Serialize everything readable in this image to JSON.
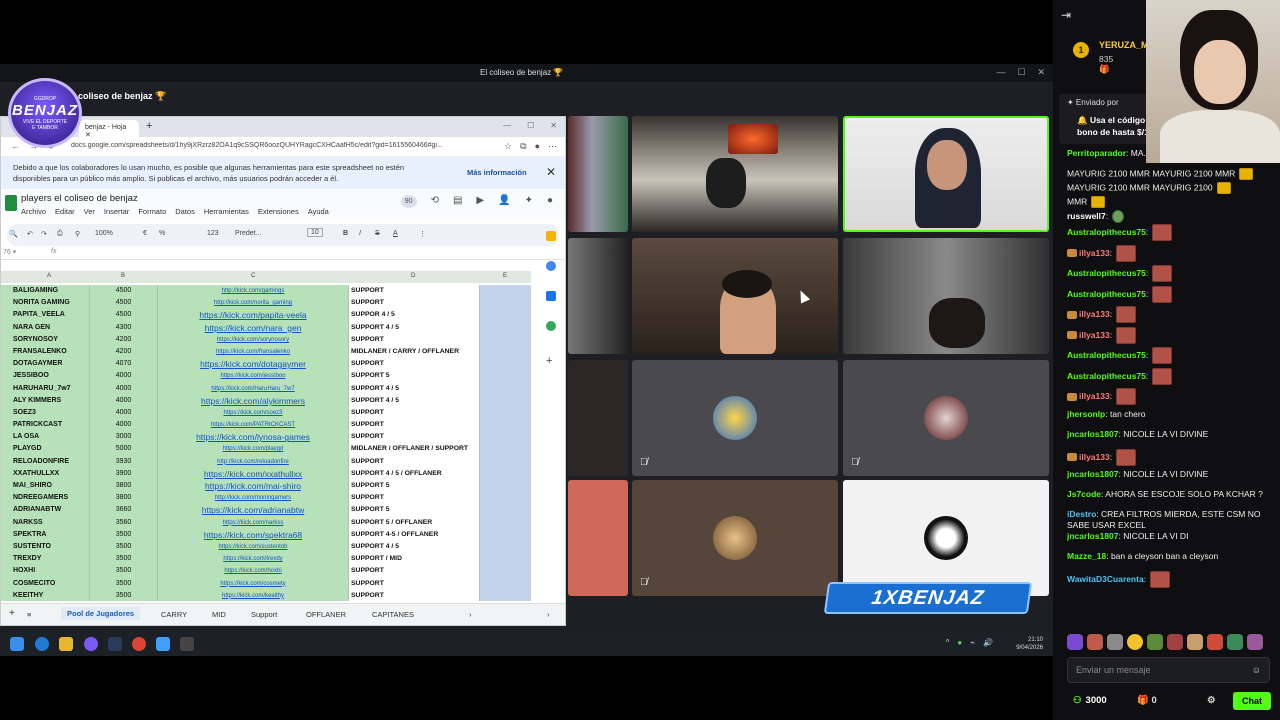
{
  "window": {
    "title": "El coliseo de benjaz 🏆",
    "server_name": "coliseo de benjaz 🏆"
  },
  "logo": {
    "main": "BENJAZ",
    "top": "GGDROP",
    "bottom": "VIVE EL DEPORTE",
    "tiny": "E TAMBOR"
  },
  "browser": {
    "tab_label": "benjaz - Hoja",
    "url": "docs.google.com/spreadsheets/d/1hy9jXRzrz82OA1q9cSSQR6oozQUHYRagcCXHCaafH5c/edit?gid=1615560466#gi..."
  },
  "notice": {
    "message": "Debido a que los colaboradores lo usan mucho, es posible que algunas herramientas para este spreadsheet no estén disponibles para un público más amplio. Si publicas el archivo, más usuarios podrán acceder a él.",
    "more": "Más información",
    "close": "✕"
  },
  "sheet": {
    "title": "players el coliseo de benjaz",
    "menus": [
      "Archivo",
      "Editar",
      "Ver",
      "Insertar",
      "Formato",
      "Datos",
      "Herramientas",
      "Extensiones",
      "Ayuda"
    ],
    "toolbar": {
      "zoom": "100%",
      "font": "Predet...",
      "size": "10",
      "currency": "€",
      "percent": "%",
      "num": "123"
    },
    "collab_count": "90",
    "columns": [
      "A",
      "B",
      "C",
      "D",
      "E"
    ],
    "rows": [
      {
        "name": "BALIGAMING",
        "mmr": "4500",
        "link": "http://kick.com/gamings",
        "role": "SUPPORT",
        "sz": "sm"
      },
      {
        "name": "NORITA GAMING",
        "mmr": "4500",
        "link": "http://kick.com/norita_gaming",
        "role": "SUPPORT",
        "sz": "sm"
      },
      {
        "name": "PAPITA_VEELA",
        "mmr": "4500",
        "link": "https://kick.com/papita-veela",
        "role": "SUPPOR 4 / 5",
        "sz": "big"
      },
      {
        "name": "NARA GEN",
        "mmr": "4300",
        "link": "https://kick.com/nara_gen",
        "role": "SUPPORT 4 / 5",
        "sz": "big"
      },
      {
        "name": "SORYNOSOY",
        "mmr": "4200",
        "link": "https://kick.com/sorynosory",
        "role": "SUPPORT",
        "sz": "sm"
      },
      {
        "name": "FRANSALENKO",
        "mmr": "4200",
        "link": "https://kick.com/fransalenko",
        "role": "MIDLANER / CARRY / OFFLANER",
        "sz": "sm"
      },
      {
        "name": "DOTAGAYMER",
        "mmr": "4070",
        "link": "https://kick.com/dotagaymer",
        "role": "SUPPORT",
        "sz": "big"
      },
      {
        "name": "JESSIBOO",
        "mmr": "4000",
        "link": "https://kick.com/jessiboo",
        "role": "SUPPORT 5",
        "sz": "sm"
      },
      {
        "name": "HARUHARU_7w7",
        "mmr": "4000",
        "link": "https://kick.com/HaruHaru_7w7",
        "role": "SUPPORT 4 / 5",
        "sz": "sm"
      },
      {
        "name": "ALY KIMMERS",
        "mmr": "4000",
        "link": "https://kick.com/alykimmers",
        "role": "SUPPORT 4 / 5",
        "sz": "big"
      },
      {
        "name": "SOEZ3",
        "mmr": "4000",
        "link": "https://kick.com/soez3",
        "role": "SUPPORT",
        "sz": "sm"
      },
      {
        "name": "PATRICKCAST",
        "mmr": "4000",
        "link": "https://kick.com/PATRICKCAST",
        "role": "SUPPORT",
        "sz": "sm"
      },
      {
        "name": "LA OSA",
        "mmr": "3000",
        "link": "https://kick.com/lynosa-games",
        "role": "SUPPORT",
        "sz": "big"
      },
      {
        "name": "PLAYGD",
        "mmr": "5000",
        "link": "https://kick.com/playgd",
        "role": "MIDLANER / OFFLANER / SUPPORT",
        "sz": "sm"
      },
      {
        "name": "RELOADONFIRE",
        "mmr": "3930",
        "link": "http://kick.com/reloadonfire",
        "role": "SUPPORT",
        "sz": "sm"
      },
      {
        "name": "XXATHULLXX",
        "mmr": "3900",
        "link": "https://kick.com/xxathullxx",
        "role": "SUPPORT 4 / 5 / OFFLANER",
        "sz": "big"
      },
      {
        "name": "MAI_SHIRO",
        "mmr": "3800",
        "link": "https://kick.com/mai-shiro",
        "role": "SUPPORT 5",
        "sz": "big"
      },
      {
        "name": "NDREEGAMERS",
        "mmr": "3800",
        "link": "http://kick.com/moningamers",
        "role": "SUPPORT",
        "sz": "sm"
      },
      {
        "name": "ADRIANABTW",
        "mmr": "3660",
        "link": "https://kick.com/adrianabtw",
        "role": "SUPPORT 5",
        "sz": "big"
      },
      {
        "name": "NARKSS",
        "mmr": "3560",
        "link": "https://kick.com/narkss",
        "role": "SUPPORT 5 / OFFLANER",
        "sz": "sm"
      },
      {
        "name": "SPEKTRA",
        "mmr": "3500",
        "link": "https://kick.com/spektra68",
        "role": "SUPPORT 4-5 / OFFLANER",
        "sz": "big"
      },
      {
        "name": "SUSTENTO",
        "mmr": "3500",
        "link": "https://kick.com/sustentob",
        "role": "SUPPORT 4 / 5",
        "sz": "sm"
      },
      {
        "name": "TREXDY",
        "mmr": "3500",
        "link": "https://kick.com/trexdy",
        "role": "SUPPORT / MID",
        "sz": "sm"
      },
      {
        "name": "HOXHI",
        "mmr": "3500",
        "link": "https://kick.com/hoxhi",
        "role": "SUPPORT",
        "sz": "sm"
      },
      {
        "name": "COSMECITO",
        "mmr": "3500",
        "link": "https://kick.com/cosmety",
        "role": "SUPPORT",
        "sz": "sm"
      },
      {
        "name": "KEEITHY",
        "mmr": "3500",
        "link": "https://kick.com/keeithy",
        "role": "SUPPORT",
        "sz": "sm"
      }
    ],
    "tabs": [
      "Pool de Jugadores",
      "CARRY",
      "MID",
      "Support",
      "OFFLANER",
      "CAPITANES"
    ]
  },
  "taskbar": {
    "time": "21:10",
    "date": "9/04/2026"
  },
  "overlay": {
    "brand": "1XBENJAZ"
  },
  "chat": {
    "top_gifter": {
      "rank": "1",
      "name": "YERUZA_M",
      "count": "835 🎁"
    },
    "pinned": {
      "header": "✦ Enviado por",
      "line1": "🔔 Usa el código 1",
      "line2": "bono de hasta $/1"
    },
    "messages": [
      {
        "user": "Perritoparador",
        "color": "#53fc18",
        "text": ": MA..",
        "emote": ""
      },
      {
        "user": "",
        "color": "",
        "text": "MAYURIG 2100 MMR  MAYURIG 2100 MMR",
        "emote": "y"
      },
      {
        "user": "",
        "color": "",
        "text": "MAYURIG 2100 MMR  MAYURIG 2100",
        "emote": "y"
      },
      {
        "user": "",
        "color": "",
        "text": "MMR",
        "emote": "y"
      },
      {
        "user": "russwell7",
        "color": "#ffffff",
        "text": ":",
        "emote": "g"
      },
      {
        "user": "Australopithecus75",
        "color": "#53fc18",
        "text": ":",
        "emote": "r"
      },
      {
        "user": "illya133",
        "color": "#ff7a7a",
        "text": ":",
        "emote": "r",
        "badge": true
      },
      {
        "user": "Australopithecus75",
        "color": "#53fc18",
        "text": ":",
        "emote": "r"
      },
      {
        "user": "Australopithecus75",
        "color": "#53fc18",
        "text": ":",
        "emote": "r"
      },
      {
        "user": "illya133",
        "color": "#ff7a7a",
        "text": ":",
        "emote": "r",
        "badge": true
      },
      {
        "user": "illya133",
        "color": "#ff7a7a",
        "text": ":",
        "emote": "r",
        "badge": true
      },
      {
        "user": "Australopithecus75",
        "color": "#53fc18",
        "text": ":",
        "emote": "r"
      },
      {
        "user": "Australopithecus75",
        "color": "#53fc18",
        "text": ":",
        "emote": "r"
      },
      {
        "user": "illya133",
        "color": "#ff7a7a",
        "text": ":",
        "emote": "r",
        "badge": true
      },
      {
        "user": "jhersonlp",
        "color": "#53fc18",
        "text": ": tan chero",
        "emote": ""
      },
      {
        "user": "jncarlos1807",
        "color": "#53fc18",
        "text": ": NICOLE LA VI DIVINE",
        "emote": ""
      },
      {
        "user": "illya133",
        "color": "#ff7a7a",
        "text": ":",
        "emote": "r",
        "badge": true
      },
      {
        "user": "jncarlos1807",
        "color": "#53fc18",
        "text": ": NICOLE LA VI DIVINE",
        "emote": ""
      },
      {
        "user": "Js7code",
        "color": "#53fc18",
        "text": ": AHORA SE ESCOJE SOLO PA KCHAR ?",
        "emote": ""
      },
      {
        "user": "iDestro",
        "color": "#4fc3f7",
        "text": ": CREA FILTROS MIERDA, ESTE CSM NO SABE USAR EXCEL",
        "emote": ""
      },
      {
        "user": "jncarlos1807",
        "color": "#53fc18",
        "text": ": NICOLE LA VI DI",
        "emote": ""
      },
      {
        "user": "Mazze_18",
        "color": "#53fc18",
        "text": ": ban a cleyson ban a cleyson",
        "emote": ""
      },
      {
        "user": "WawitaD3Cuarenta",
        "color": "#4fc3f7",
        "text": ":",
        "emote": "r"
      }
    ],
    "input_placeholder": "Enviar un mensaje",
    "points": "3000",
    "zero": "0",
    "send_label": "Chat"
  }
}
